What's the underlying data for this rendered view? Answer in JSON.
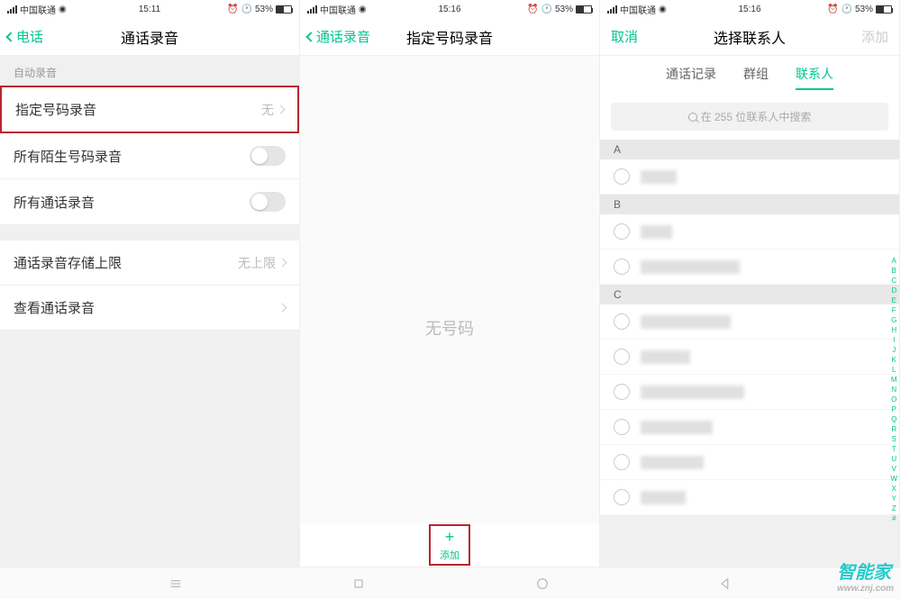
{
  "status": {
    "carrier": "中国联通",
    "battery": "53%",
    "time1": "15:11",
    "time2": "15:16",
    "time3": "15:16"
  },
  "screen1": {
    "back_label": "电话",
    "title": "通话录音",
    "section_auto": "自动录音",
    "item_specific": "指定号码录音",
    "value_none": "无",
    "item_unknown": "所有陌生号码录音",
    "item_all": "所有通话录音",
    "item_storage": "通话录音存储上限",
    "value_unlimited": "无上限",
    "item_view": "查看通话录音"
  },
  "screen2": {
    "back_label": "通话录音",
    "title": "指定号码录音",
    "empty": "无号码",
    "add": "添加"
  },
  "screen3": {
    "cancel": "取消",
    "title": "选择联系人",
    "add": "添加",
    "tab_calls": "通话记录",
    "tab_groups": "群组",
    "tab_contacts": "联系人",
    "search_placeholder": "在 255 位联系人中搜索",
    "section_a": "A",
    "section_b": "B",
    "section_c": "C",
    "alpha_index": [
      "A",
      "B",
      "C",
      "D",
      "E",
      "F",
      "G",
      "H",
      "I",
      "J",
      "K",
      "L",
      "M",
      "N",
      "O",
      "P",
      "Q",
      "R",
      "S",
      "T",
      "U",
      "V",
      "W",
      "X",
      "Y",
      "Z",
      "#"
    ]
  },
  "watermark": {
    "main": "智能家",
    "sub": "www.znj.com"
  }
}
